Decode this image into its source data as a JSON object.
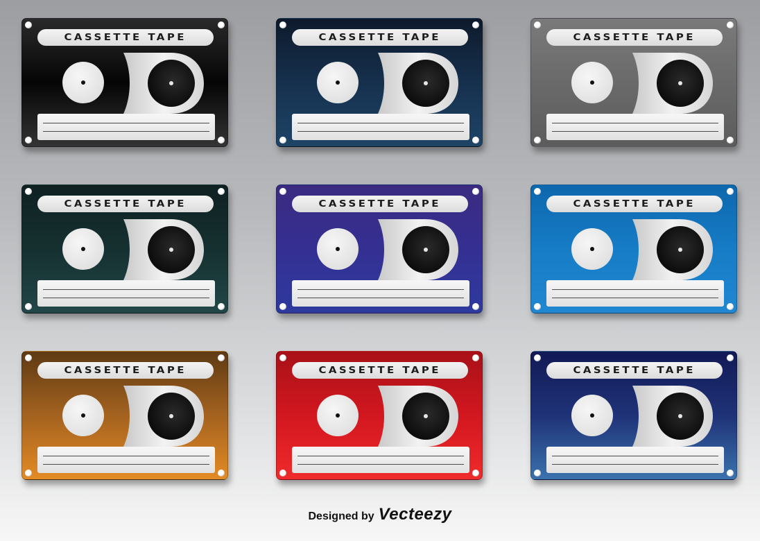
{
  "cassette_label": "CASSETTE TAPE",
  "cassettes": [
    {
      "color_top": "#2a2a2a",
      "color_mid": "#050505",
      "color_bottom": "#333333"
    },
    {
      "color_top": "#0e1a2c",
      "color_mid": "#16304d",
      "color_bottom": "#1e4466"
    },
    {
      "color_top": "#7a7a7a",
      "color_mid": "#6a6a6a",
      "color_bottom": "#5c5c5c"
    },
    {
      "color_top": "#0f2122",
      "color_mid": "#163030",
      "color_bottom": "#224748"
    },
    {
      "color_top": "#3b2b80",
      "color_mid": "#352f92",
      "color_bottom": "#2d3a9e"
    },
    {
      "color_top": "#0e67ad",
      "color_mid": "#167cc6",
      "color_bottom": "#2187d0"
    },
    {
      "color_top": "#5e3a14",
      "color_mid": "#a4621f",
      "color_bottom": "#e38b25"
    },
    {
      "color_top": "#a81118",
      "color_mid": "#d2171f",
      "color_bottom": "#ef2b2b"
    },
    {
      "color_top": "#121a56",
      "color_mid": "#1f3277",
      "color_bottom": "#3a72ad"
    }
  ],
  "credit": {
    "prefix": "Designed by",
    "brand": "Vecteezy"
  }
}
